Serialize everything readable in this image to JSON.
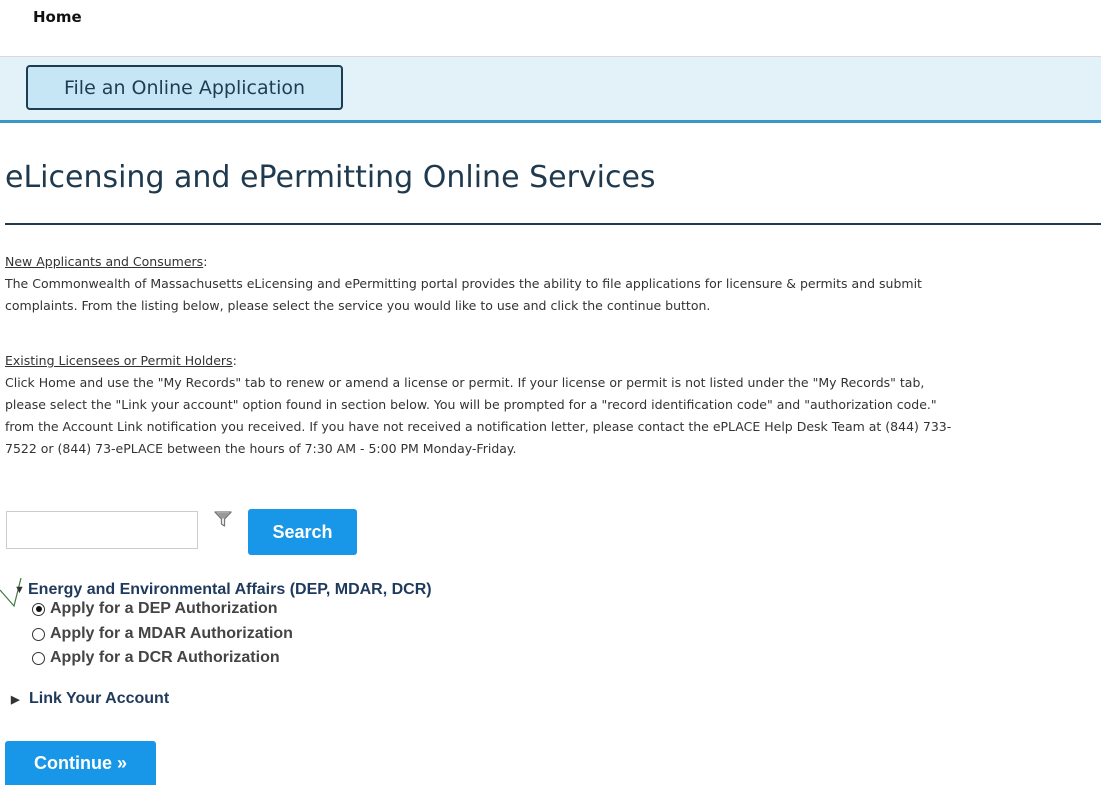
{
  "nav": {
    "home_label": "Home"
  },
  "actions": {
    "file_online_app_label": "File an Online Application"
  },
  "page": {
    "title": "eLicensing and ePermitting Online Services"
  },
  "info": {
    "new_heading": "New Applicants and Consumers",
    "new_heading_suffix": ":",
    "new_lines": [
      "The Commonwealth of Massachusetts eLicensing and ePermitting portal provides the ability to file applications for licensure & permits and submit",
      "complaints. From the listing below, please select the service you would like to use and click the continue button."
    ],
    "existing_heading": "Existing Licensees or Permit Holders",
    "existing_heading_suffix": ":",
    "existing_lines": [
      "Click Home and use the \"My Records\" tab to renew or amend a license or permit. If your license or permit is not listed under the \"My Records\" tab,",
      "please select the \"Link your account\" option found in section below. You will be prompted for a \"record identification code\" and \"authorization code.\"",
      "from the Account Link notification you received. If you have not received a notification letter, please contact the ePLACE Help Desk Team at (844) 733-",
      "7522 or (844) 73-ePLACE between the hours of 7:30 AM - 5:00 PM Monday-Friday."
    ]
  },
  "search": {
    "value": "",
    "button_label": "Search",
    "filter_icon": "filter-icon"
  },
  "tree": {
    "group_label": "Energy and Environmental Affairs (DEP, MDAR, DCR)",
    "options": [
      {
        "label": "Apply for a DEP Authorization",
        "selected": true
      },
      {
        "label": "Apply for a MDAR Authorization",
        "selected": false
      },
      {
        "label": "Apply for a DCR Authorization",
        "selected": false
      }
    ],
    "link_account_label": "Link Your Account"
  },
  "continue_label": "Continue »",
  "colors": {
    "accent": "#1896e8",
    "title": "#1f3a4f",
    "action_bar_bg": "#e3f1f8",
    "annotation_arrow": "#3f7a3f"
  }
}
